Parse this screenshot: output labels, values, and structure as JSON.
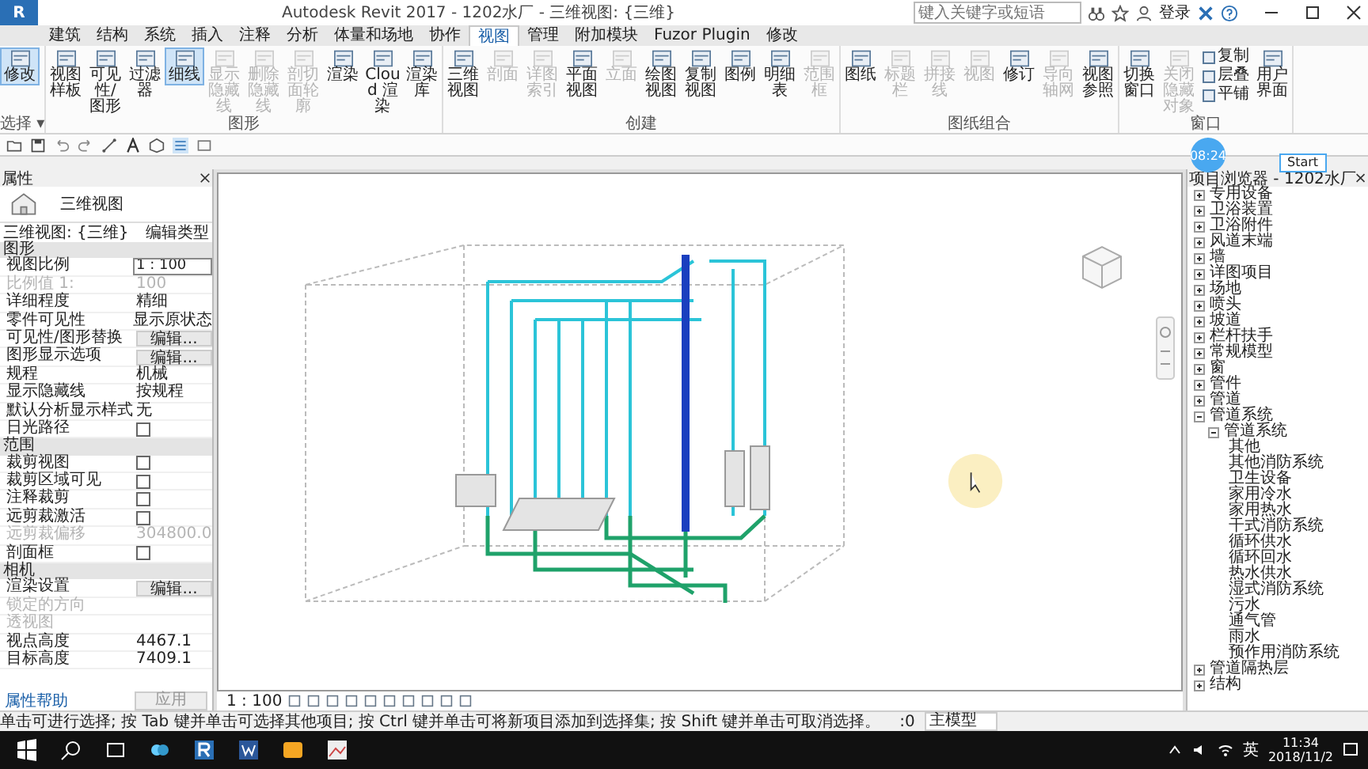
{
  "window": {
    "app_button": "R",
    "title": "Autodesk Revit 2017 -   1202水厂 -   三维视图: {三维}",
    "search_placeholder": "键入关键字或短语",
    "sign_in": "登录"
  },
  "tabs": [
    {
      "label": "建筑",
      "selected": false
    },
    {
      "label": "结构",
      "selected": false
    },
    {
      "label": "系统",
      "selected": false
    },
    {
      "label": "插入",
      "selected": false
    },
    {
      "label": "注释",
      "selected": false
    },
    {
      "label": "分析",
      "selected": false
    },
    {
      "label": "体量和场地",
      "selected": false
    },
    {
      "label": "协作",
      "selected": false
    },
    {
      "label": "视图",
      "selected": true
    },
    {
      "label": "管理",
      "selected": false
    },
    {
      "label": "附加模块",
      "selected": false
    },
    {
      "label": "Fuzor Plugin",
      "selected": false
    },
    {
      "label": "修改",
      "selected": false
    }
  ],
  "ribbon_panels": [
    {
      "title": "选择 ▾",
      "groups": [
        {
          "kind": "large",
          "tools": [
            {
              "label": "修改",
              "on": true,
              "disabled": false
            }
          ]
        }
      ]
    },
    {
      "title": "图形",
      "groups": [
        {
          "kind": "large",
          "tools": [
            {
              "label": "视图样板",
              "on": false,
              "disabled": false
            },
            {
              "label": "可见性/图形",
              "on": false,
              "disabled": false
            },
            {
              "label": "过滤器",
              "on": false,
              "disabled": false
            },
            {
              "label": "细线",
              "on": true,
              "disabled": false
            },
            {
              "label": "显示隐藏线",
              "on": false,
              "disabled": true
            },
            {
              "label": "删除隐藏线",
              "on": false,
              "disabled": true
            },
            {
              "label": "剖切面轮廓",
              "on": false,
              "disabled": true
            },
            {
              "label": "渲染",
              "on": false,
              "disabled": false
            },
            {
              "label": "Cloud 渲染",
              "on": false,
              "disabled": false
            },
            {
              "label": "渲染库",
              "on": false,
              "disabled": false
            }
          ]
        }
      ]
    },
    {
      "title": "创建",
      "groups": [
        {
          "kind": "large",
          "tools": [
            {
              "label": "三维视图",
              "on": false,
              "disabled": false
            },
            {
              "label": "剖面",
              "on": false,
              "disabled": true
            },
            {
              "label": "详图索引",
              "on": false,
              "disabled": true
            },
            {
              "label": "平面视图",
              "on": false,
              "disabled": false
            },
            {
              "label": "立面",
              "on": false,
              "disabled": true
            },
            {
              "label": "绘图视图",
              "on": false,
              "disabled": false
            },
            {
              "label": "复制视图",
              "on": false,
              "disabled": false
            },
            {
              "label": "图例",
              "on": false,
              "disabled": false
            },
            {
              "label": "明细表",
              "on": false,
              "disabled": false
            },
            {
              "label": "范围框",
              "on": false,
              "disabled": true
            }
          ]
        }
      ]
    },
    {
      "title": "图纸组合",
      "groups": [
        {
          "kind": "large",
          "tools": [
            {
              "label": "图纸",
              "on": false,
              "disabled": false
            },
            {
              "label": "标题栏",
              "on": false,
              "disabled": true
            },
            {
              "label": "拼接线",
              "on": false,
              "disabled": true
            },
            {
              "label": "视图",
              "on": false,
              "disabled": true
            },
            {
              "label": "修订",
              "on": false,
              "disabled": false
            },
            {
              "label": "导向轴网",
              "on": false,
              "disabled": true
            },
            {
              "label": "视图参照",
              "on": false,
              "disabled": false
            }
          ]
        }
      ]
    },
    {
      "title": "窗口",
      "groups": [
        {
          "kind": "large",
          "tools": [
            {
              "label": "切换窗口",
              "on": false,
              "disabled": false
            },
            {
              "label": "关闭隐藏对象",
              "on": false,
              "disabled": true
            }
          ]
        },
        {
          "kind": "stack",
          "tools": [
            {
              "label": "复制",
              "on": false,
              "disabled": false
            },
            {
              "label": "层叠",
              "on": false,
              "disabled": false
            },
            {
              "label": "平铺",
              "on": false,
              "disabled": false
            }
          ]
        },
        {
          "kind": "large",
          "tools": [
            {
              "label": "用户界面",
              "on": false,
              "disabled": false
            }
          ]
        }
      ]
    }
  ],
  "badges": {
    "timer": "08:24",
    "start": "Start"
  },
  "properties": {
    "title": "属性",
    "type_name": "三维视图",
    "instance": "三维视图: {三维}",
    "edit_type": "编辑类型",
    "sections": [
      {
        "title": "图形",
        "rows": [
          {
            "label": "视图比例",
            "kind": "field",
            "value": "1 : 100",
            "disabled": false
          },
          {
            "label": "比例值 1:",
            "kind": "text",
            "value": "100",
            "disabled": true
          },
          {
            "label": "详细程度",
            "kind": "text",
            "value": "精细",
            "disabled": false
          },
          {
            "label": "零件可见性",
            "kind": "text",
            "value": "显示原状态",
            "disabled": false
          },
          {
            "label": "可见性/图形替换",
            "kind": "button",
            "value": "编辑...",
            "disabled": false
          },
          {
            "label": "图形显示选项",
            "kind": "button",
            "value": "编辑...",
            "disabled": false
          },
          {
            "label": "规程",
            "kind": "text",
            "value": "机械",
            "disabled": false
          },
          {
            "label": "显示隐藏线",
            "kind": "text",
            "value": "按规程",
            "disabled": false
          },
          {
            "label": "默认分析显示样式",
            "kind": "text",
            "value": "无",
            "disabled": false
          },
          {
            "label": "日光路径",
            "kind": "check",
            "checked": false,
            "disabled": false
          }
        ]
      },
      {
        "title": "范围",
        "rows": [
          {
            "label": "裁剪视图",
            "kind": "check",
            "checked": false,
            "disabled": false
          },
          {
            "label": "裁剪区域可见",
            "kind": "check",
            "checked": false,
            "disabled": false
          },
          {
            "label": "注释裁剪",
            "kind": "check",
            "checked": false,
            "disabled": false
          },
          {
            "label": "远剪裁激活",
            "kind": "check",
            "checked": false,
            "disabled": false
          },
          {
            "label": "远剪裁偏移",
            "kind": "text",
            "value": "304800.0",
            "disabled": true
          },
          {
            "label": "剖面框",
            "kind": "check",
            "checked": false,
            "disabled": false
          }
        ]
      },
      {
        "title": "相机",
        "rows": [
          {
            "label": "渲染设置",
            "kind": "button",
            "value": "编辑...",
            "disabled": false
          },
          {
            "label": "锁定的方向",
            "kind": "text",
            "disabled": true
          },
          {
            "label": "透视图",
            "kind": "text",
            "disabled": true
          },
          {
            "label": "视点高度",
            "kind": "text",
            "value": "4467.1",
            "disabled": false
          },
          {
            "label": "目标高度",
            "kind": "text",
            "value": "7409.1",
            "disabled": false
          }
        ]
      }
    ],
    "help": "属性帮助",
    "apply": "应用"
  },
  "browser": {
    "title": "项目浏览器 - 1202水厂",
    "items": [
      {
        "label": "专用设备",
        "expanded": false
      },
      {
        "label": "卫浴装置",
        "expanded": false
      },
      {
        "label": "卫浴附件",
        "expanded": false
      },
      {
        "label": "风道末端",
        "expanded": false
      },
      {
        "label": "墙",
        "expanded": false
      },
      {
        "label": "详图项目",
        "expanded": false
      },
      {
        "label": "场地",
        "expanded": false
      },
      {
        "label": "喷头",
        "expanded": false
      },
      {
        "label": "坡道",
        "expanded": false
      },
      {
        "label": "栏杆扶手",
        "expanded": false
      },
      {
        "label": "常规模型",
        "expanded": false
      },
      {
        "label": "窗",
        "expanded": false
      },
      {
        "label": "管件",
        "expanded": false
      },
      {
        "label": "管道",
        "expanded": false
      },
      {
        "label": "管道系统",
        "expanded": true,
        "children": [
          {
            "label": "管道系统",
            "expanded": true,
            "children": [
              {
                "label": "其他"
              },
              {
                "label": "其他消防系统"
              },
              {
                "label": "卫生设备"
              },
              {
                "label": "家用冷水"
              },
              {
                "label": "家用热水"
              },
              {
                "label": "干式消防系统"
              },
              {
                "label": "循环供水"
              },
              {
                "label": "循环回水"
              },
              {
                "label": "热水供水"
              },
              {
                "label": "湿式消防系统"
              },
              {
                "label": "污水"
              },
              {
                "label": "通气管"
              },
              {
                "label": "雨水"
              },
              {
                "label": "预作用消防系统"
              }
            ]
          }
        ]
      },
      {
        "label": "管道隔热层",
        "expanded": false
      },
      {
        "label": "结构",
        "expanded": false
      }
    ]
  },
  "view_bar": {
    "scale": "1 : 100"
  },
  "status_bar": {
    "message": "单击可进行选择; 按 Tab 键并单击可选择其他项目; 按 Ctrl 键并单击可将新项目添加到选择集; 按 Shift 键并单击可取消选择。",
    "count": ":0",
    "model": "主模型"
  },
  "taskbar": {
    "ime": "英",
    "time": "11:34",
    "date": "2018/11/2"
  }
}
